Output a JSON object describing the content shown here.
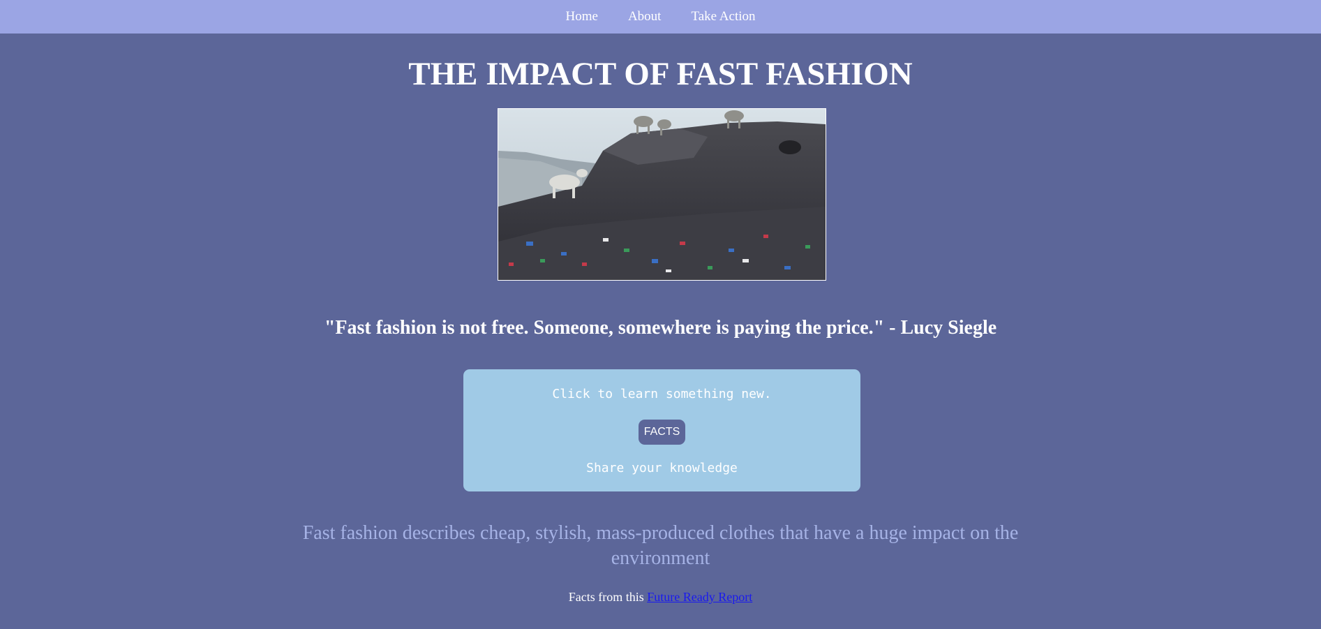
{
  "nav": {
    "items": [
      {
        "label": "Home"
      },
      {
        "label": "About"
      },
      {
        "label": "Take Action"
      }
    ]
  },
  "page": {
    "title": "THE IMPACT OF FAST FASHION",
    "quote": "\"Fast fashion is not free. Someone, somewhere is paying the price.\" - Lucy Siegle",
    "description": "Fast fashion describes cheap, stylish, mass-produced clothes that have a huge impact on the environment"
  },
  "card": {
    "prompt": "Click to learn something new.",
    "button_label": "FACTS",
    "share_text": "Share your knowledge"
  },
  "source": {
    "prefix": "Facts from this",
    "link_text": "Future Ready Report"
  },
  "colors": {
    "background": "#5c6699",
    "nav": "#9ba5e4",
    "card": "#a0cae6",
    "description": "#a6b3e6",
    "link": "#1a1aee"
  }
}
